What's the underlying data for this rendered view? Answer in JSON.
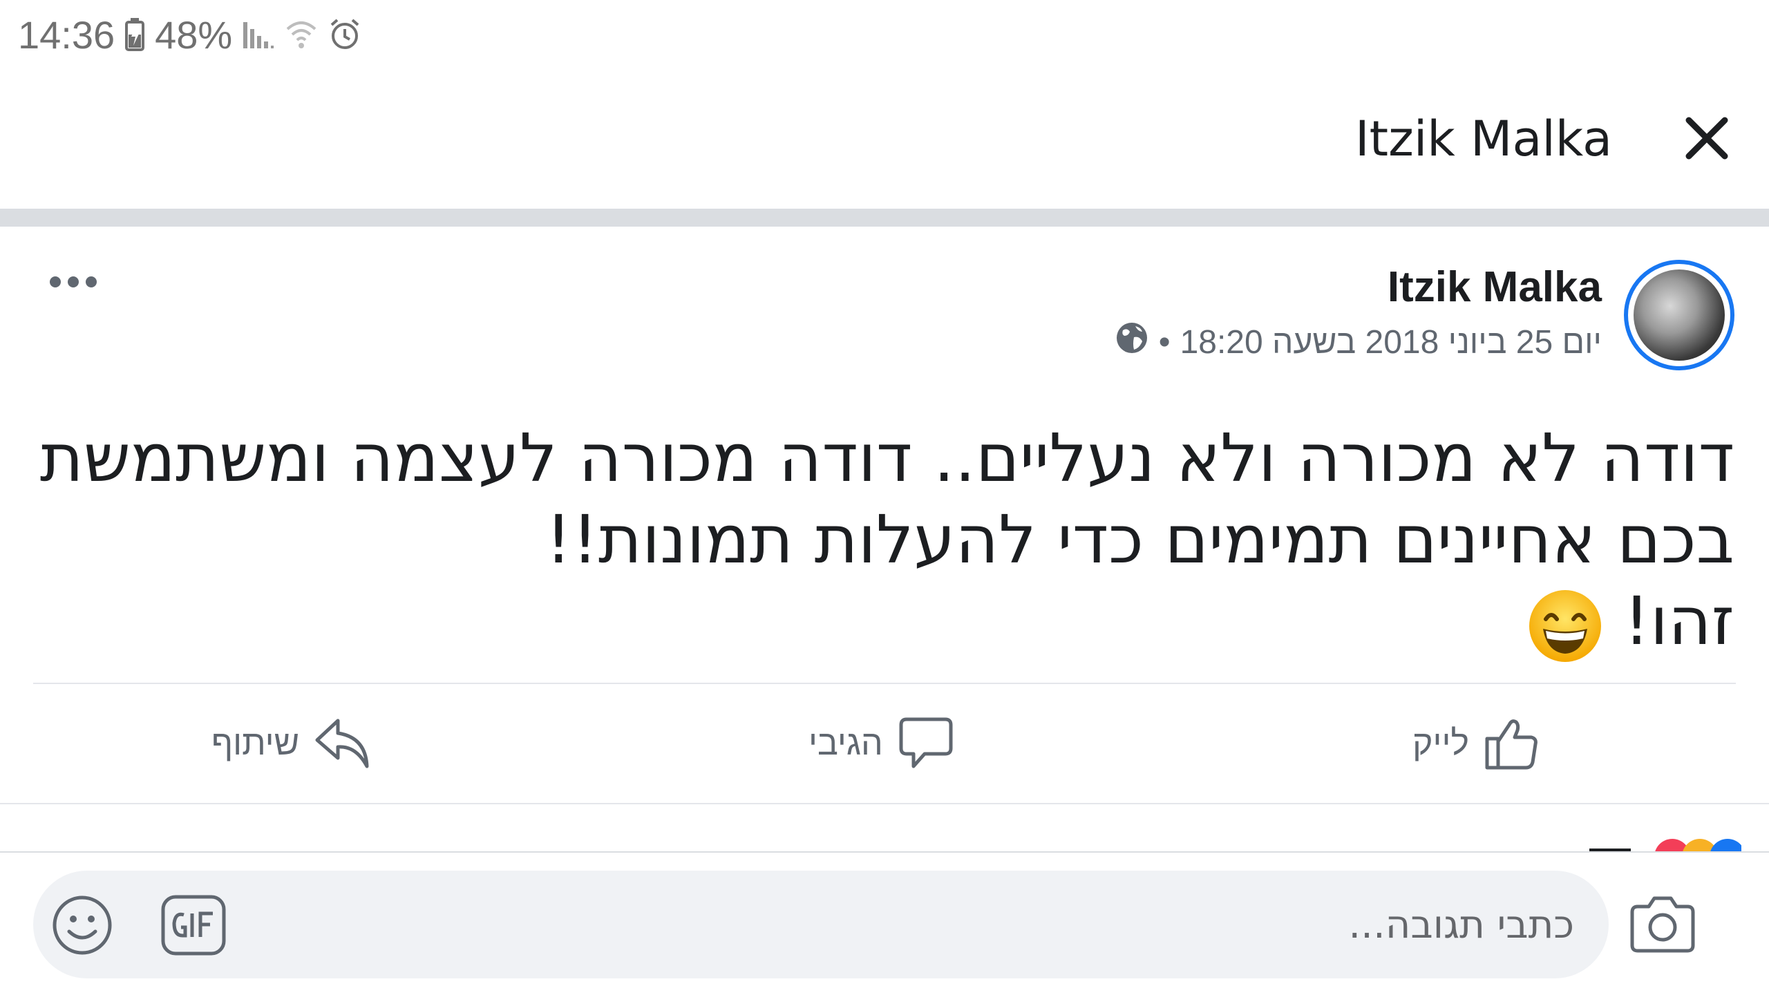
{
  "status_bar": {
    "time": "14:36",
    "battery": "48%"
  },
  "header": {
    "title": "Itzik Malka"
  },
  "post": {
    "author": "Itzik Malka",
    "date": "יום 25 ביוני 2018 בשעה 18:20",
    "separator": "•",
    "text_lines": [
      "דודה לא מכורה ולא נעליים.. דודה מכורה לעצמה ומשתמשת",
      "בכם אחיינים תמימים כדי להעלות תמונות!!",
      "זהו!"
    ]
  },
  "actions": {
    "like": "לייק",
    "comment": "הגיבי",
    "share": "שיתוף"
  },
  "composer": {
    "placeholder": "כתבי תגובה..."
  }
}
